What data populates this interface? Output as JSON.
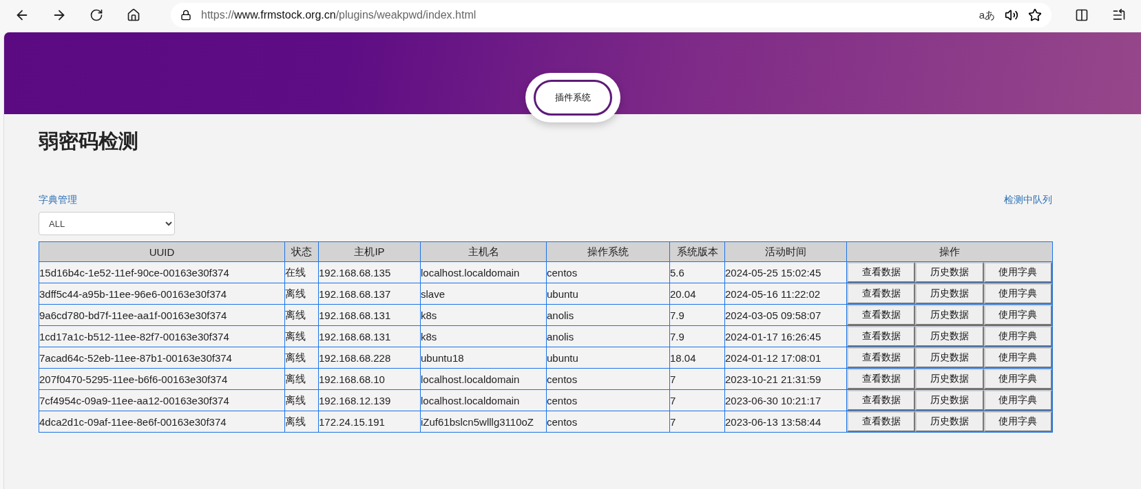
{
  "browser": {
    "url": {
      "scheme": "https://",
      "host": "www.frmstock.org.cn",
      "path": "/plugins/weakpwd/index.html"
    },
    "read_aloud_label": "aあ"
  },
  "header": {
    "badge": "插件系统"
  },
  "page": {
    "title": "弱密码检测",
    "dictionary_link": "字典管理",
    "queue_link": "检测中队列",
    "filter": {
      "value": "ALL"
    }
  },
  "table": {
    "columns": [
      "UUID",
      "状态",
      "主机IP",
      "主机名",
      "操作系统",
      "系统版本",
      "活动时间",
      "操作"
    ],
    "rows": [
      {
        "cells": [
          "15d16b4c-1e52-11ef-90ce-00163e30f374",
          "在线",
          "192.168.68.135",
          "localhost.localdomain",
          "centos",
          "5.6",
          "2024-05-25 15:02:45"
        ],
        "actions": [
          "查看数据",
          "历史数据",
          "使用字典"
        ]
      },
      {
        "cells": [
          "3dff5c44-a95b-11ee-96e6-00163e30f374",
          "离线",
          "192.168.68.137",
          "slave",
          "ubuntu",
          "20.04",
          "2024-05-16 11:22:02"
        ],
        "actions": [
          "查看数据",
          "历史数据",
          "使用字典"
        ]
      },
      {
        "cells": [
          "9a6cd780-bd7f-11ee-aa1f-00163e30f374",
          "离线",
          "192.168.68.131",
          "k8s",
          "anolis",
          "7.9",
          "2024-03-05 09:58:07"
        ],
        "actions": [
          "查看数据",
          "历史数据",
          "使用字典"
        ]
      },
      {
        "cells": [
          "1cd17a1c-b512-11ee-82f7-00163e30f374",
          "离线",
          "192.168.68.131",
          "k8s",
          "anolis",
          "7.9",
          "2024-01-17 16:26:45"
        ],
        "actions": [
          "查看数据",
          "历史数据",
          "使用字典"
        ]
      },
      {
        "cells": [
          "7acad64c-52eb-11ee-87b1-00163e30f374",
          "离线",
          "192.168.68.228",
          "ubuntu18",
          "ubuntu",
          "18.04",
          "2024-01-12 17:08:01"
        ],
        "actions": [
          "查看数据",
          "历史数据",
          "使用字典"
        ]
      },
      {
        "cells": [
          "207f0470-5295-11ee-b6f6-00163e30f374",
          "离线",
          "192.168.68.10",
          "localhost.localdomain",
          "centos",
          "7",
          "2023-10-21 21:31:59"
        ],
        "actions": [
          "查看数据",
          "历史数据",
          "使用字典"
        ]
      },
      {
        "cells": [
          "7cf4954c-09a9-11ee-aa12-00163e30f374",
          "离线",
          "192.168.12.139",
          "localhost.localdomain",
          "centos",
          "7",
          "2023-06-30 10:21:17"
        ],
        "actions": [
          "查看数据",
          "历史数据",
          "使用字典"
        ]
      },
      {
        "cells": [
          "4dca2d1c-09af-11ee-8e6f-00163e30f374",
          "离线",
          "172.24.15.191",
          "iZuf61bslcn5wlllg3110oZ",
          "centos",
          "7",
          "2023-06-13 13:58:44"
        ],
        "actions": [
          "查看数据",
          "历史数据",
          "使用字典"
        ]
      }
    ]
  }
}
